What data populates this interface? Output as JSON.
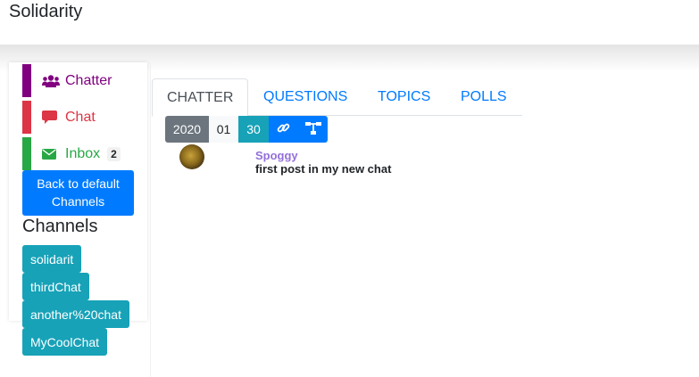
{
  "app": {
    "title": "Solidarity"
  },
  "sidebar": {
    "nav": [
      {
        "label": "Chatter",
        "icon": "users-icon",
        "color": "#800080"
      },
      {
        "label": "Chat",
        "icon": "comment-icon",
        "color": "#dc3545"
      },
      {
        "label": "Inbox",
        "icon": "envelope-icon",
        "color": "#28a745",
        "badge": "2"
      }
    ],
    "default_button": "Back to default Channels",
    "channels_heading": "Channels",
    "channels": [
      "solidarit",
      "thirdChat",
      "another%20chat",
      "MyCoolChat"
    ]
  },
  "tabs": [
    "CHATTER",
    "QUESTIONS",
    "TOPICS",
    "POLLS"
  ],
  "active_tab": "CHATTER",
  "date": {
    "year": "2020",
    "month": "01",
    "day": "30"
  },
  "date_actions": [
    "link-icon",
    "sitemap-icon"
  ],
  "post": {
    "author": "Spoggy",
    "text": "first post in my new chat"
  },
  "colors": {
    "primary": "#007bff",
    "info": "#17a2b8",
    "secondary": "#6c757d",
    "author": "#9370db"
  }
}
